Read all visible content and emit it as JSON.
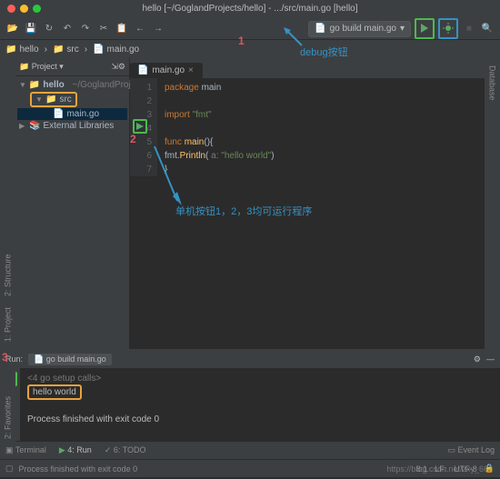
{
  "title": "hello [~/GoglandProjects/hello] - .../src/main.go [hello]",
  "toolbar": {
    "run_config": "go build main.go"
  },
  "annotations": {
    "num1": "1",
    "num2": "2",
    "num3": "3",
    "debug_label": "debug按钮",
    "note": "单机按钮1，2，3均可运行程序"
  },
  "breadcrumb": {
    "proj": "hello",
    "folder": "src",
    "file": "main.go"
  },
  "left_tabs": {
    "project": "1: Project",
    "structure": "2: Structure",
    "favorites": "2: Favorites"
  },
  "right_tabs": {
    "database": "Database"
  },
  "project_pane": {
    "header": "Project",
    "root": "hello",
    "root_path": "~/GoglandProjects/hel",
    "src": "src",
    "main": "main.go",
    "ext_libs": "External Libraries"
  },
  "editor": {
    "tab": "main.go",
    "lines": [
      "1",
      "2",
      "3",
      "4",
      "5",
      "6",
      "7"
    ],
    "l1_kw": "package",
    "l1_id": "main",
    "l3_kw": "import",
    "l3_str": "\"fmt\"",
    "l5_kw": "func",
    "l5_fn": "main",
    "l5_rest": "(){",
    "l6_pre": "    fmt.",
    "l6_fn": "Println",
    "l6_mid": "(",
    "l6_hint": "a:",
    "l6_str": "\"hello world\"",
    "l6_end": ")",
    "l7": "}"
  },
  "run": {
    "header_label": "Run:",
    "header_config": "go build main.go",
    "prompt_line": "<4 go setup calls>",
    "output": "hello world",
    "exit": "Process finished with exit code 0",
    "gear_icon": "⚙"
  },
  "bottom": {
    "terminal": "Terminal",
    "run": "4: Run",
    "todo": "6: TODO",
    "event": "Event Log"
  },
  "status": {
    "msg": "Process finished with exit code 0",
    "pos": "8:1",
    "encoding": "LF:",
    "indent": "UTF-8",
    "lock": "🔒"
  },
  "watermark": "https://blog.csdn.net/zxy_666"
}
